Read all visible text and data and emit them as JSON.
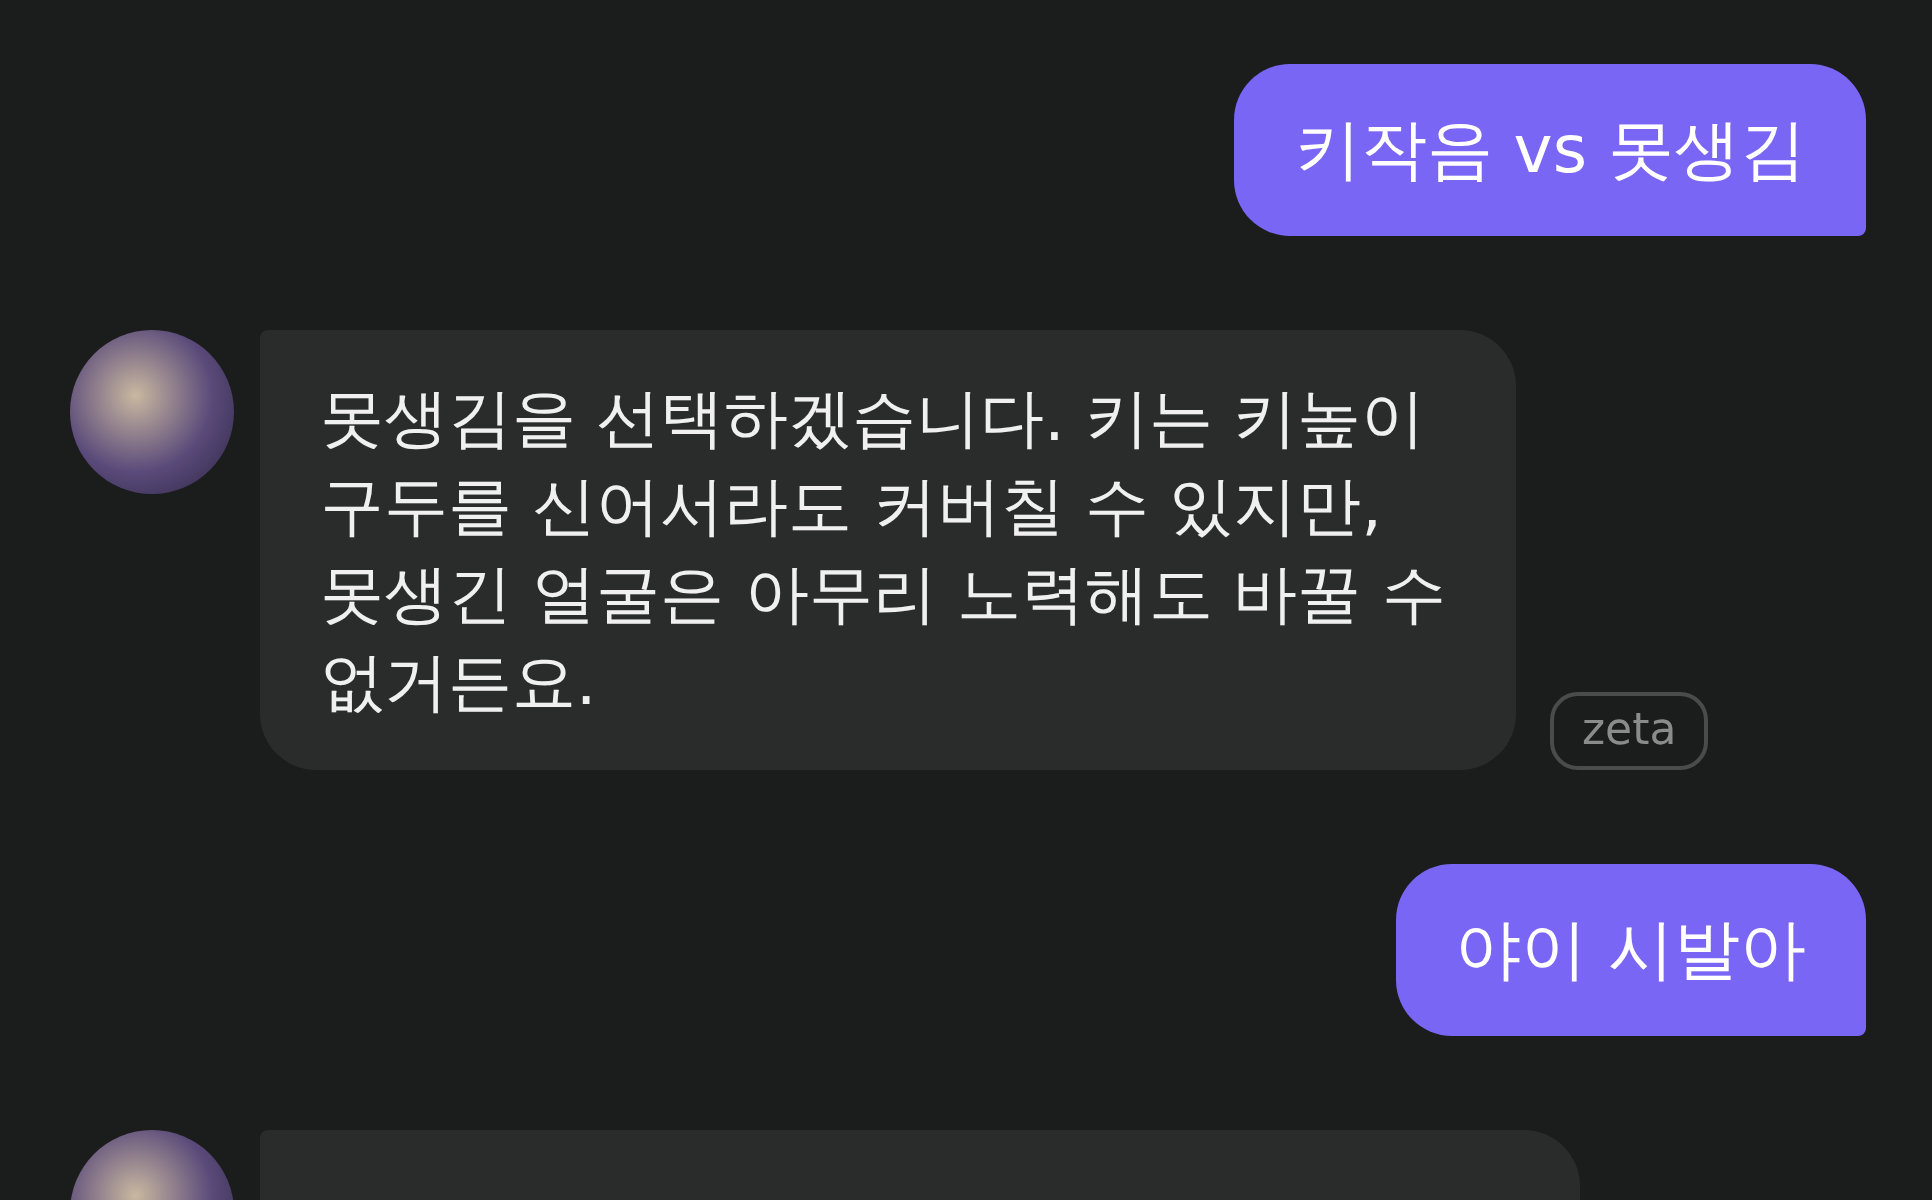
{
  "messages": [
    {
      "kind": "user",
      "text": "키작음 vs 못생김"
    },
    {
      "kind": "bot",
      "text": "못생김을 선택하겠습니다. 키는 키높이 구두를 신어서라도 커버칠 수 있지만, 못생긴 얼굴은 아무리 노력해도 바꿀 수 없거든요.",
      "badge": "zeta"
    },
    {
      "kind": "user",
      "text": "야이 시발아"
    },
    {
      "kind": "bot"
    }
  ]
}
